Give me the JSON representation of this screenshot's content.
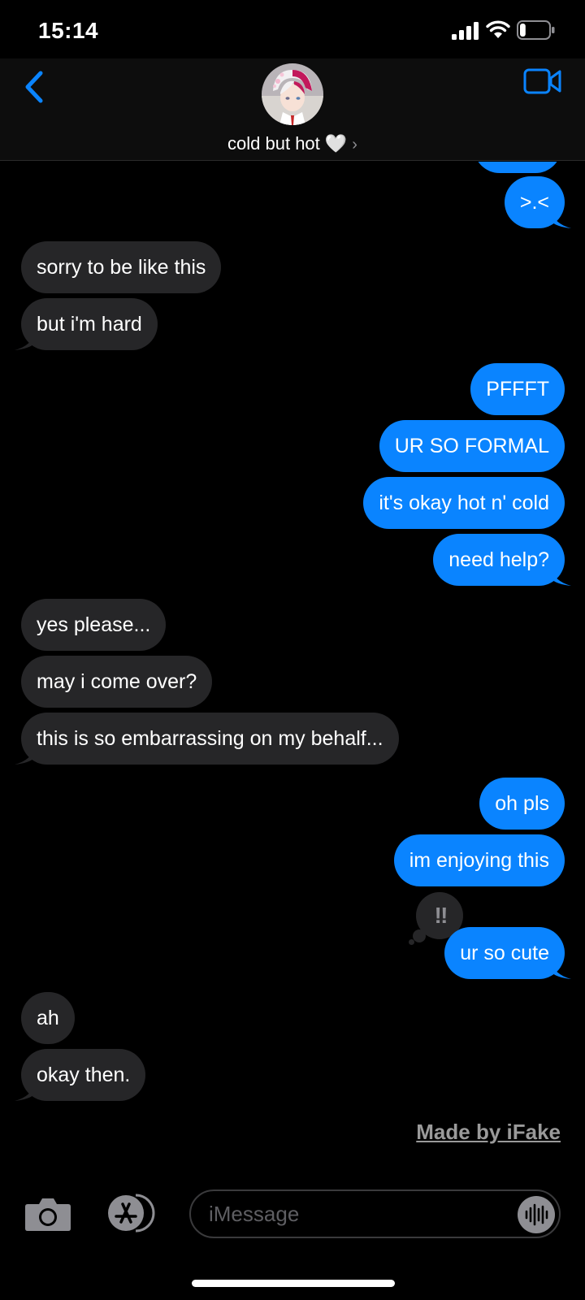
{
  "status_bar": {
    "time": "15:14",
    "battery_percent": 20
  },
  "header": {
    "contact_name": "cold but hot 🤍",
    "chevron": "›"
  },
  "messages": [
    {
      "dir": "out",
      "text": ">.<"
    },
    {
      "dir": "in",
      "text": "sorry to be like this"
    },
    {
      "dir": "in",
      "text": "but i'm hard"
    },
    {
      "dir": "out",
      "text": "PFFFT"
    },
    {
      "dir": "out",
      "text": "UR SO FORMAL"
    },
    {
      "dir": "out",
      "text": "it's okay hot n' cold"
    },
    {
      "dir": "out",
      "text": "need help?"
    },
    {
      "dir": "in",
      "text": "yes please..."
    },
    {
      "dir": "in",
      "text": "may i come over?"
    },
    {
      "dir": "in",
      "text": "this is so embarrassing on my behalf..."
    },
    {
      "dir": "out",
      "text": "oh pls"
    },
    {
      "dir": "out",
      "text": "im enjoying this"
    },
    {
      "dir": "out",
      "text": "ur so cute",
      "reaction": "‼"
    },
    {
      "dir": "in",
      "text": "ah"
    },
    {
      "dir": "in",
      "text": "okay then."
    }
  ],
  "watermark": "Made by iFake",
  "input": {
    "placeholder": "iMessage"
  },
  "colors": {
    "outgoing": "#0a84ff",
    "incoming": "#262628",
    "accent": "#0a84ff"
  },
  "icons": [
    "signal-icon",
    "wifi-icon",
    "battery-icon",
    "back-icon",
    "video-camera-icon",
    "camera-icon",
    "appstore-icon",
    "audio-waveform-icon"
  ]
}
